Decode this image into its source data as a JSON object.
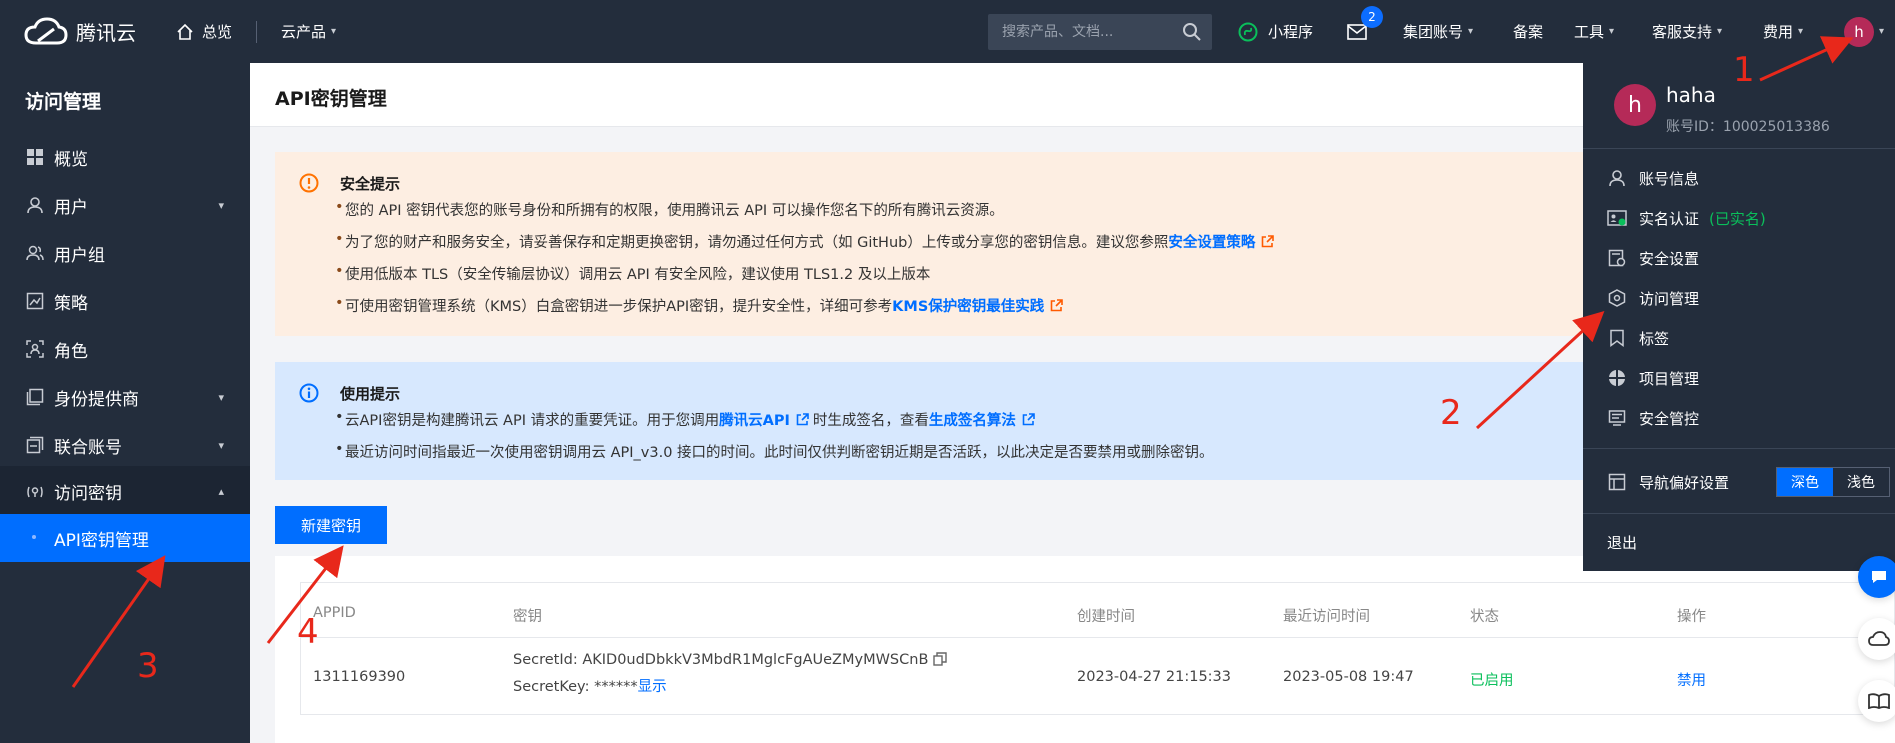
{
  "topbar": {
    "logo_text": "腾讯云",
    "home_label": "总览",
    "products_label": "云产品",
    "search_placeholder": "搜索产品、文档...",
    "mini_program": "小程序",
    "mail_badge": "2",
    "group_account": "集团账号",
    "filing": "备案",
    "tools": "工具",
    "support": "客服支持",
    "fees": "费用",
    "avatar_letter": "h"
  },
  "sidebar": {
    "title": "访问管理",
    "items": [
      {
        "label": "概览",
        "icon": "overview-icon"
      },
      {
        "label": "用户",
        "icon": "user-icon"
      },
      {
        "label": "用户组",
        "icon": "user-group-icon"
      },
      {
        "label": "策略",
        "icon": "policy-icon"
      },
      {
        "label": "角色",
        "icon": "role-icon"
      },
      {
        "label": "身份提供商",
        "icon": "identity-provider-icon"
      },
      {
        "label": "联合账号",
        "icon": "federated-account-icon"
      },
      {
        "label": "访问密钥",
        "icon": "access-key-icon"
      },
      {
        "label": "API密钥管理",
        "icon": ""
      }
    ]
  },
  "main": {
    "title": "API密钥管理",
    "security_notice": {
      "title": "安全提示",
      "lines": [
        "您的 API 密钥代表您的账号身份和所拥有的权限，使用腾讯云 API 可以操作您名下的所有腾讯云资源。",
        "为了您的财产和服务安全，请妥善保存和定期更换密钥，请勿通过任何方式（如 GitHub）上传或分享您的密钥信息。建议您参照",
        "使用低版本 TLS（安全传输层协议）调用云 API 有安全风险，建议使用 TLS1.2 及以上版本",
        "可使用密钥管理系统（KMS）白盒密钥进一步保护API密钥，提升安全性，详细可参考"
      ],
      "link_security_policy": "安全设置策略",
      "link_kms": "KMS保护密钥最佳实践"
    },
    "usage_notice": {
      "title": "使用提示",
      "line1_a": "云API密钥是构建腾讯云 API 请求的重要凭证。用于您调用",
      "line1_link1": "腾讯云API",
      "line1_b": "时生成签名，查看",
      "line1_link2": "生成签名算法",
      "line2": "最近访问时间指最近一次使用密钥调用云 API_v3.0 接口的时间。此时间仅供判断密钥近期是否活跃，以此决定是否要禁用或删除密钥。"
    },
    "new_key_button": "新建密钥",
    "table": {
      "headers": [
        "APPID",
        "密钥",
        "创建时间",
        "最近访问时间",
        "状态",
        "操作"
      ],
      "rows": [
        {
          "appid": "1311169390",
          "secret_id": "SecretId: AKID0udDbkkV3MbdR1MglcFgAUeZMyMWSCnB",
          "secret_key": "SecretKey: ******",
          "show": "显示",
          "created": "2023-04-27 21:15:33",
          "last_access": "2023-05-08 19:47",
          "status": "已启用",
          "action": "禁用"
        }
      ]
    }
  },
  "account_dropdown": {
    "avatar_letter": "h",
    "name": "haha",
    "account_id": "账号ID：100025013386",
    "items": [
      {
        "label": "账号信息",
        "icon": "account-info-icon"
      },
      {
        "label": "实名认证",
        "icon": "real-name-icon",
        "extra": "(已实名)"
      },
      {
        "label": "安全设置",
        "icon": "security-settings-icon"
      },
      {
        "label": "访问管理",
        "icon": "access-management-icon"
      },
      {
        "label": "标签",
        "icon": "tag-icon"
      },
      {
        "label": "项目管理",
        "icon": "project-icon"
      },
      {
        "label": "安全管控",
        "icon": "security-control-icon"
      }
    ],
    "nav_pref": "导航偏好设置",
    "theme_dark": "深色",
    "theme_light": "浅色",
    "logout": "退出"
  },
  "annotations": [
    "1",
    "2",
    "3",
    "4"
  ],
  "colors": {
    "topbar_bg": "#232d3c",
    "accent": "#006eff",
    "warning_bg": "#fdeee2",
    "info_bg": "#d7e8fe",
    "success": "#0abf5b",
    "annotation_red": "#e8281b"
  }
}
